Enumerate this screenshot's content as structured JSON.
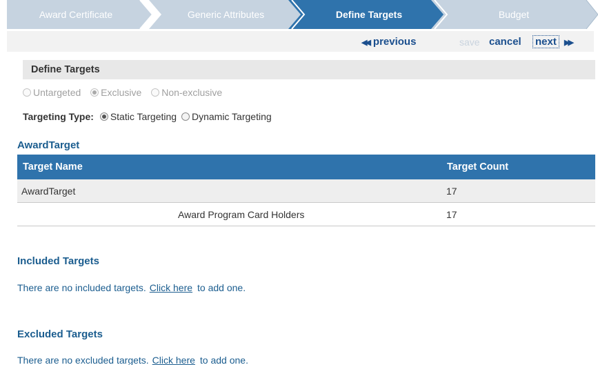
{
  "wizard": {
    "steps": [
      {
        "label": "Award Certificate",
        "state": "inactive"
      },
      {
        "label": "Generic Attributes",
        "state": "inactive"
      },
      {
        "label": "Define Targets",
        "state": "active"
      },
      {
        "label": "Budget",
        "state": "inactive"
      }
    ]
  },
  "nav": {
    "previous": "previous",
    "save": "save",
    "cancel": "cancel",
    "next": "next"
  },
  "section": {
    "title": "Define Targets"
  },
  "targeting_mode": {
    "options": [
      "Untargeted",
      "Exclusive",
      "Non-exclusive"
    ],
    "selected": "Exclusive",
    "disabled": true
  },
  "targeting_type": {
    "label": "Targeting Type:",
    "options": [
      "Static Targeting",
      "Dynamic Targeting"
    ],
    "selected": "Static Targeting"
  },
  "award_target": {
    "heading": "AwardTarget",
    "columns": [
      "Target Name",
      "Target Count"
    ],
    "rows": [
      {
        "name": "AwardTarget",
        "count": "17"
      },
      {
        "name": "Award Program Card Holders",
        "count": "17"
      }
    ]
  },
  "included": {
    "heading": "Included Targets",
    "text_before": "There are no included targets.",
    "link": "Click here",
    "text_after": "to add one."
  },
  "excluded": {
    "heading": "Excluded Targets",
    "text_before": "There are no excluded targets.",
    "link": "Click here",
    "text_after": "to add one."
  },
  "colors": {
    "step_inactive": "#c6d3e0",
    "step_active": "#2f73ac",
    "link_blue": "#1b4f8e",
    "heading_blue": "#1b5d8f",
    "table_header": "#2f73ac"
  }
}
